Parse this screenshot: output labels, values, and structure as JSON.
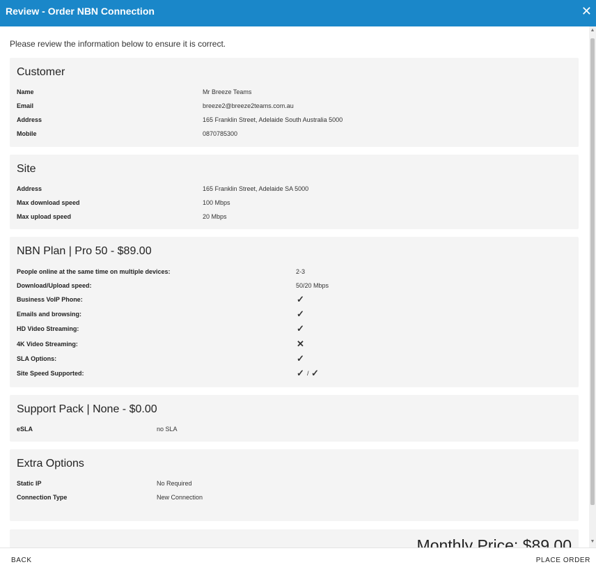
{
  "dialog": {
    "title": "Review - Order NBN Connection",
    "close_icon": "close-icon"
  },
  "intro": "Please review the information below to ensure it is correct.",
  "customer": {
    "heading": "Customer",
    "rows": [
      {
        "label": "Name",
        "value": "Mr Breeze Teams"
      },
      {
        "label": "Email",
        "value": "breeze2@breeze2teams.com.au"
      },
      {
        "label": "Address",
        "value": "165 Franklin Street, Adelaide South Australia 5000"
      },
      {
        "label": "Mobile",
        "value": "0870785300"
      }
    ]
  },
  "site": {
    "heading": "Site",
    "rows": [
      {
        "label": "Address",
        "value": "165 Franklin Street, Adelaide SA 5000"
      },
      {
        "label": "Max download speed",
        "value": "100 Mbps"
      },
      {
        "label": "Max upload speed",
        "value": "20 Mbps"
      }
    ]
  },
  "plan": {
    "heading": "NBN Plan | Pro 50 - $89.00",
    "rows": [
      {
        "label": "People online at the same time on multiple devices:",
        "value": "2-3"
      },
      {
        "label": "Download/Upload speed:",
        "value": "50/20 Mbps"
      },
      {
        "label": "Business VoIP Phone:",
        "value": "✓"
      },
      {
        "label": "Emails and browsing:",
        "value": "✓"
      },
      {
        "label": "HD Video Streaming:",
        "value": "✓"
      },
      {
        "label": "4K Video Streaming:",
        "value": "✕"
      },
      {
        "label": "SLA Options:",
        "value": "✓"
      },
      {
        "label": "Site Speed Supported:",
        "value_a": "✓",
        "separator": "/",
        "value_b": "✓"
      }
    ]
  },
  "support": {
    "heading": "Support Pack | None - $0.00",
    "rows": [
      {
        "label": "eSLA",
        "value": "no SLA"
      }
    ]
  },
  "extras": {
    "heading": "Extra Options",
    "rows": [
      {
        "label": "Static IP",
        "value": "No Required"
      },
      {
        "label": "Connection Type",
        "value": "New Connection"
      }
    ]
  },
  "summary": {
    "monthly": "Monthly Price: $89.00"
  },
  "footer": {
    "back": "BACK",
    "place_order": "PLACE ORDER"
  },
  "colors": {
    "header": "#1a87c9",
    "check": "#3fa34d",
    "cross": "#e53935",
    "panel": "#f4f4f4"
  }
}
